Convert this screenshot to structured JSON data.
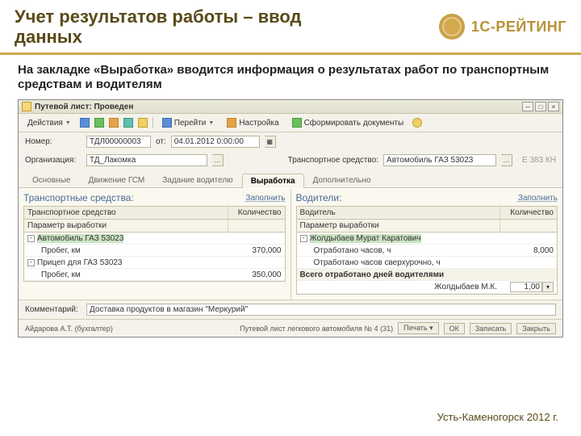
{
  "slide": {
    "title": "Учет результатов работы – ввод данных",
    "brand": "1С-РЕЙТИНГ",
    "subtitle": "На закладке «Выработка» вводится информация о результатах работ по транспортным средствам и водителям",
    "footer": "Усть-Каменогорск  2012 г."
  },
  "window": {
    "title": "Путевой лист: Проведен",
    "toolbar": {
      "actions": "Действия",
      "go": "Перейти",
      "settings": "Настройка",
      "form_docs": "Сформировать документы"
    },
    "form": {
      "number_lbl": "Номер:",
      "number_val": "ТДЛ00000003",
      "from_lbl": "от:",
      "date_val": "04.01.2012 0:00:00",
      "org_lbl": "Организация:",
      "org_val": "ТД_Лакомка",
      "ts_lbl": "Транспортное средство:",
      "ts_val": "Автомобиль ГАЗ 53023",
      "ts_hint": "Е 383 КН"
    },
    "tabs": [
      "Основные",
      "Движение ГСМ",
      "Задание водителю",
      "Выработка",
      "Дополнительно"
    ],
    "active_tab": 3,
    "left": {
      "title": "Транспортные средства:",
      "fill": "Заполнить",
      "col1": "Транспортное средство",
      "col2": "Количество",
      "sub1": "Параметр выработки",
      "rows": [
        {
          "toggle": "-",
          "text": "Автомобиль ГАЗ 53023",
          "val": "",
          "sel": true
        },
        {
          "toggle": "",
          "text": "Пробег, км",
          "val": "370,000"
        },
        {
          "toggle": "-",
          "text": "Прицеп для ГАЗ 53023",
          "val": ""
        },
        {
          "toggle": "",
          "text": "Пробег, км",
          "val": "350,000"
        }
      ]
    },
    "right": {
      "title": "Водители:",
      "fill": "Заполнить",
      "col1": "Водитель",
      "col2": "Количество",
      "sub1": "Параметр выработки",
      "rows": [
        {
          "toggle": "-",
          "text": "Жолдыбаев Мурат Каратович",
          "val": "",
          "sel": true
        },
        {
          "toggle": "",
          "text": "Отработано часов, ч",
          "val": "8,000"
        },
        {
          "toggle": "",
          "text": "Отработано часов сверхурочно, ч",
          "val": ""
        }
      ],
      "sum_label": "Всего отработано дней водителями",
      "sum_row": {
        "name": "Жолдыбаев М.К.",
        "val": "1,00"
      }
    },
    "comment_lbl": "Комментарий:",
    "comment_val": "Доставка продуктов в магазин \"Меркурий\"",
    "status": {
      "user": "Айдарова А.Т. (бухгалтер)",
      "doc": "Путевой лист легкового автомобиля № 4 (31)",
      "print": "Печать",
      "ok": "ОК",
      "save": "Записать",
      "close": "Закрыть"
    }
  }
}
